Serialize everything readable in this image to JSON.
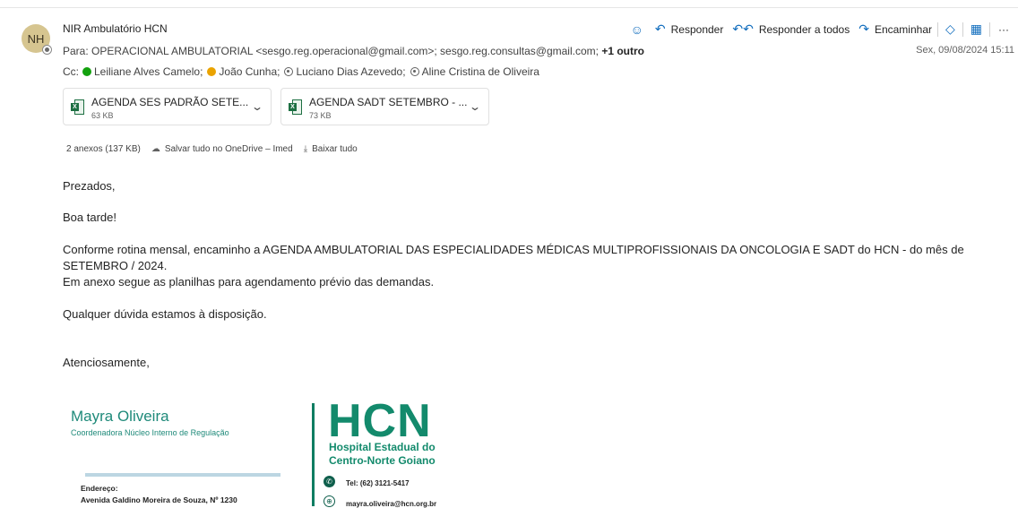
{
  "sender": {
    "initials": "NH",
    "name": "NIR Ambulatório HCN"
  },
  "to": {
    "label": "Para:",
    "recipients": "OPERACIONAL AMBULATORIAL <sesgo.reg.operacional@gmail.com>;  sesgo.reg.consultas@gmail.com;",
    "more": "+1 outro"
  },
  "cc": {
    "label": "Cc:",
    "people": [
      {
        "name": "Leiliane Alves Camelo;",
        "status": "green"
      },
      {
        "name": "João Cunha;",
        "status": "yellow"
      },
      {
        "name": "Luciano Dias Azevedo;",
        "status": "gray"
      },
      {
        "name": "Aline Cristina de Oliveira",
        "status": "gray"
      }
    ]
  },
  "actions": {
    "reply": "Responder",
    "reply_all": "Responder a todos",
    "forward": "Encaminhar",
    "more": "···"
  },
  "datetime": "Sex, 09/08/2024 15:11",
  "attachments": [
    {
      "name": "AGENDA SES PADRÃO SETE...",
      "size": "63 KB"
    },
    {
      "name": "AGENDA SADT SETEMBRO - ...",
      "size": "73 KB"
    }
  ],
  "attachment_summary": {
    "count": "2 anexos (137 KB)",
    "save_onedrive": "Salvar tudo no OneDrive – Imed",
    "download_all": "Baixar tudo"
  },
  "body": {
    "greeting": "Prezados,",
    "salutation": "Boa tarde!",
    "line1": "Conforme rotina mensal, encaminho a AGENDA AMBULATORIAL DAS ESPECIALIDADES MÉDICAS MULTIPROFISSIONAIS DA ONCOLOGIA E SADT do HCN - do mês de",
    "line2": "SETEMBRO / 2024.",
    "line3": "Em anexo segue as planilhas para agendamento prévio das demandas.",
    "line4": "Qualquer dúvida estamos à disposição.",
    "closing": "Atenciosamente,"
  },
  "signature": {
    "name": "Mayra Oliveira",
    "role": "Coordenadora Núcleo Interno de Regulação",
    "address_label": "Endereço:",
    "address": "Avenida Galdino Moreira de Souza, Nº 1230",
    "logo": "HCN",
    "hospital_line1": "Hospital Estadual do",
    "hospital_line2": "Centro-Norte Goiano",
    "tel": "Tel: (62) 3121-5417",
    "email": "mayra.oliveira@hcn.org.br"
  },
  "colors": {
    "accent": "#0f6cbd",
    "brand_green": "#138a6c",
    "avatar": "#d6c590"
  }
}
